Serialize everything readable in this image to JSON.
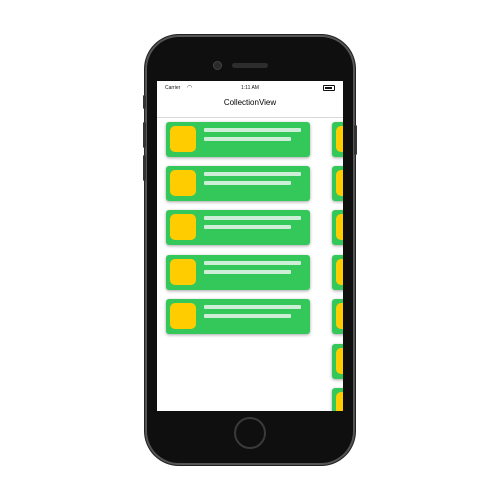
{
  "status_bar": {
    "carrier": "Carrier",
    "time": "1:11 AM"
  },
  "nav": {
    "title": "CollectionView"
  },
  "colors": {
    "cell": "#34c759",
    "thumbnail": "#ffcc00",
    "placeholder_line": "#cfeed7"
  },
  "cells": [
    {
      "id": "cell-1"
    },
    {
      "id": "cell-2"
    },
    {
      "id": "cell-3"
    },
    {
      "id": "cell-4"
    },
    {
      "id": "cell-5"
    }
  ],
  "side_cells": [
    {
      "id": "side-1"
    },
    {
      "id": "side-2"
    },
    {
      "id": "side-3"
    },
    {
      "id": "side-4"
    },
    {
      "id": "side-5"
    },
    {
      "id": "side-6"
    },
    {
      "id": "side-7"
    }
  ]
}
